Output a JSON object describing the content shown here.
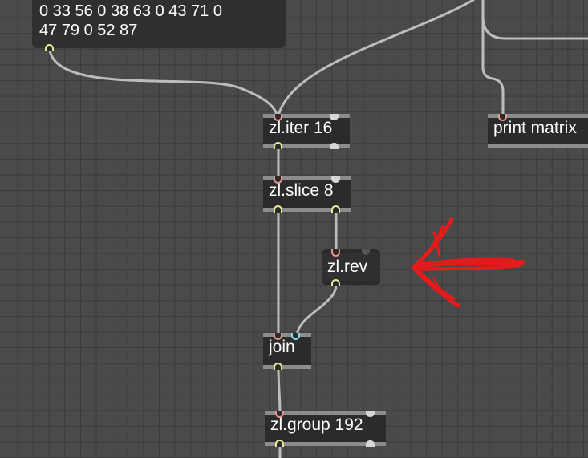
{
  "patcher": {
    "message_box": {
      "line1": "0 33 56 0 38 63 0 43 71 0",
      "line2": "47 79 0 52 87"
    },
    "objects": {
      "iter": "zl.iter 16",
      "print": "print matrix",
      "slice": "zl.slice 8",
      "rev": "zl.rev",
      "join": "join",
      "group": "zl.group 192"
    },
    "annotation": {
      "type": "hand-drawn-arrow",
      "color": "#e31b1b",
      "points_to": "zl.rev"
    },
    "colors": {
      "canvas": "#4a4a4a",
      "grid": "#3b3b3b",
      "object_bg": "#2b2b2b",
      "object_border": "#8c8c8c",
      "patch_cord": "#bdbdbd",
      "inlet": "#e6958c",
      "outlet": "#e8e79a",
      "annotation": "#e31b1b"
    }
  }
}
